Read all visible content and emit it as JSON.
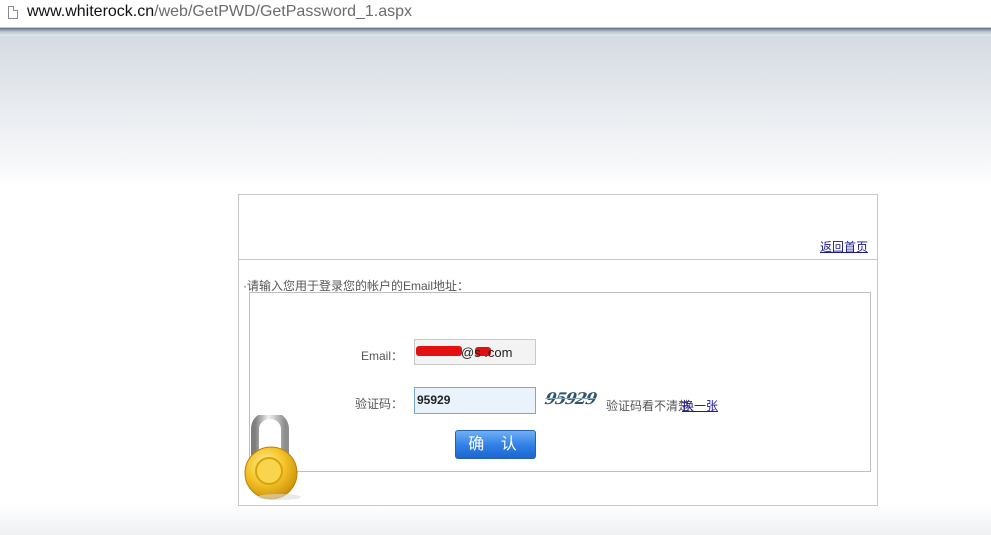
{
  "browser": {
    "url_host": "www.whiterock.cn",
    "url_path": "/web/GetPWD/GetPassword_1.aspx",
    "page_icon": "document-icon"
  },
  "panel": {
    "home_link": "返回首页",
    "prompt": "·请输入您用于登录您的帐户的Email地址："
  },
  "form": {
    "email_label": "Email：",
    "email_value": "@s  .com",
    "captcha_label": "验证码：",
    "captcha_value": "95929",
    "captcha_image_text": "95929",
    "captcha_hint": "验证码看不清楚,",
    "captcha_refresh": "换一张",
    "confirm_label": "确 认"
  },
  "decoration": {
    "lock_icon": "padlock-icon"
  },
  "colors": {
    "link": "#1a1a8a",
    "button": "#2f7ee6",
    "redaction": "#e21010"
  }
}
